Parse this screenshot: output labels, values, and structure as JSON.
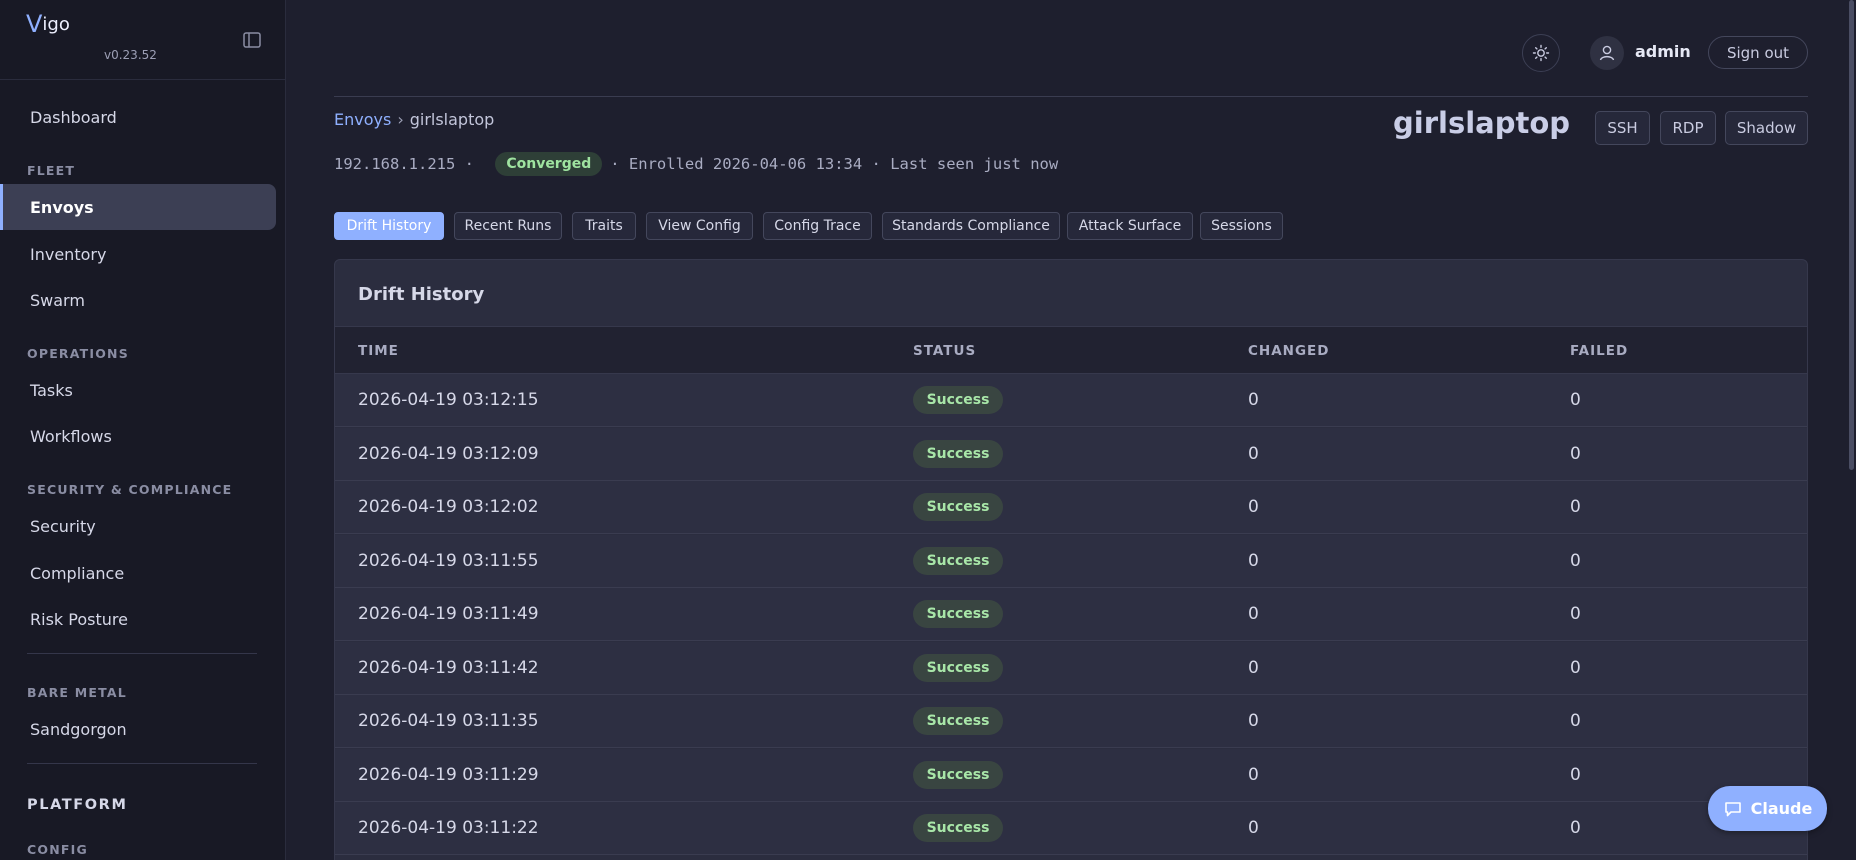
{
  "app": {
    "logo_v": "V",
    "logo_rest": "igo",
    "version": "v0.23.52"
  },
  "sidebar": {
    "dashboard": "Dashboard",
    "sections": {
      "fleet": "FLEET",
      "operations": "OPERATIONS",
      "security_compliance": "SECURITY & COMPLIANCE",
      "bare_metal": "BARE METAL",
      "platform": "PLATFORM",
      "config": "CONFIG"
    },
    "items": {
      "envoys": "Envoys",
      "inventory": "Inventory",
      "swarm": "Swarm",
      "tasks": "Tasks",
      "workflows": "Workflows",
      "security": "Security",
      "compliance": "Compliance",
      "risk_posture": "Risk Posture",
      "sandgorgon": "Sandgorgon"
    },
    "active_item": "Envoys"
  },
  "topbar": {
    "username": "admin",
    "signout_label": "Sign out",
    "theme_icon": "sun-icon",
    "avatar_icon": "user-icon"
  },
  "breadcrumb": {
    "parent": "Envoys",
    "separator": "›",
    "current": "girlslaptop"
  },
  "host": {
    "title": "girlslaptop",
    "ip": "192.168.1.215",
    "dot1": " · ",
    "status": "Converged",
    "enrolled_text": "· Enrolled 2026-04-06 13:34 · Last seen just now",
    "buttons": {
      "ssh": "SSH",
      "rdp": "RDP",
      "shadow": "Shadow"
    }
  },
  "tabs": {
    "drift_history": "Drift History",
    "recent_runs": "Recent Runs",
    "traits": "Traits",
    "view_config": "View Config",
    "config_trace": "Config Trace",
    "standards_compliance": "Standards Compliance",
    "attack_surface": "Attack Surface",
    "sessions": "Sessions",
    "active": "Drift History"
  },
  "drift": {
    "title": "Drift History",
    "columns": {
      "time": "TIME",
      "status": "STATUS",
      "changed": "CHANGED",
      "failed": "FAILED"
    },
    "rows": [
      {
        "time": "2026-04-19 03:12:15",
        "status": "Success",
        "changed": "0",
        "failed": "0"
      },
      {
        "time": "2026-04-19 03:12:09",
        "status": "Success",
        "changed": "0",
        "failed": "0"
      },
      {
        "time": "2026-04-19 03:12:02",
        "status": "Success",
        "changed": "0",
        "failed": "0"
      },
      {
        "time": "2026-04-19 03:11:55",
        "status": "Success",
        "changed": "0",
        "failed": "0"
      },
      {
        "time": "2026-04-19 03:11:49",
        "status": "Success",
        "changed": "0",
        "failed": "0"
      },
      {
        "time": "2026-04-19 03:11:42",
        "status": "Success",
        "changed": "0",
        "failed": "0"
      },
      {
        "time": "2026-04-19 03:11:35",
        "status": "Success",
        "changed": "0",
        "failed": "0"
      },
      {
        "time": "2026-04-19 03:11:29",
        "status": "Success",
        "changed": "0",
        "failed": "0"
      },
      {
        "time": "2026-04-19 03:11:22",
        "status": "Success",
        "changed": "0",
        "failed": "0"
      }
    ]
  },
  "assistant": {
    "label": "Claude",
    "icon": "chat-icon"
  },
  "colors": {
    "accent": "#8fb0ff",
    "success_text": "#a8e6a8",
    "background": "#1e1f2e",
    "sidebar": "#181925"
  }
}
